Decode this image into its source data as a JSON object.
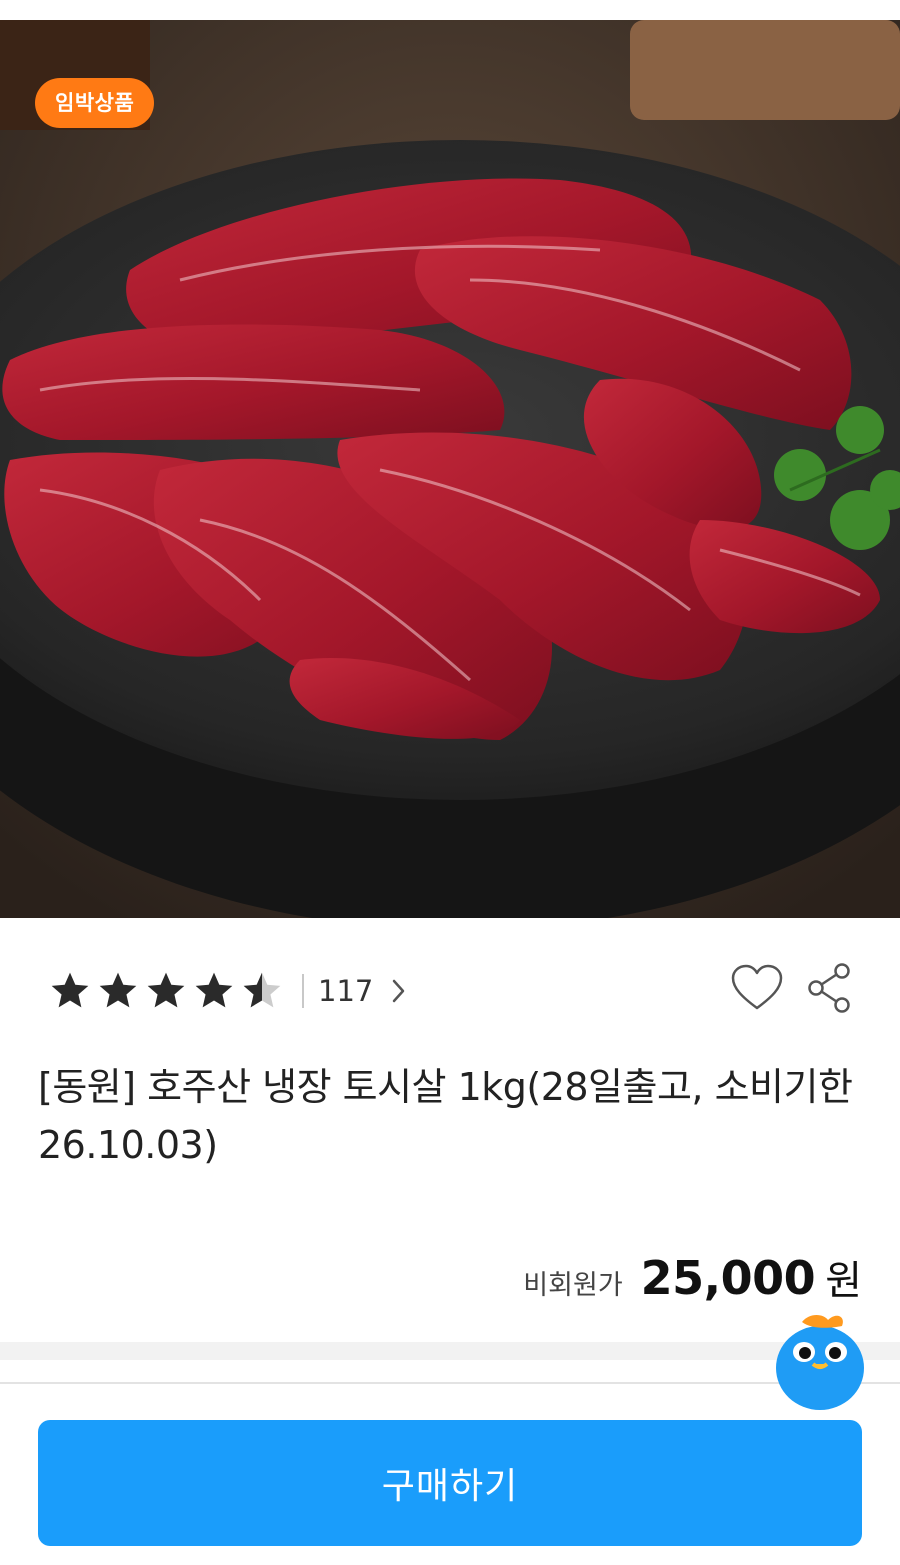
{
  "product": {
    "badge": "임박상품",
    "image_alt": "",
    "rating": 4.5,
    "review_count": "117",
    "title": "[동원] 호주산 냉장 토시살 1kg(28일출고, 소비기한26.10.03)",
    "price_label": "비회원가",
    "price": "25,000",
    "price_unit": "원"
  },
  "actions": {
    "buy_label": "구매하기"
  },
  "icons": {
    "review_more": "chevron-right-icon",
    "like": "heart-icon",
    "share": "share-icon",
    "chatbot": "mascot-icon",
    "rating": "star-icon"
  },
  "colors": {
    "badge": "#ff7a14",
    "buy_button": "#1a9dfb",
    "star": "#2a2a2a",
    "star_empty": "#cccccc"
  }
}
